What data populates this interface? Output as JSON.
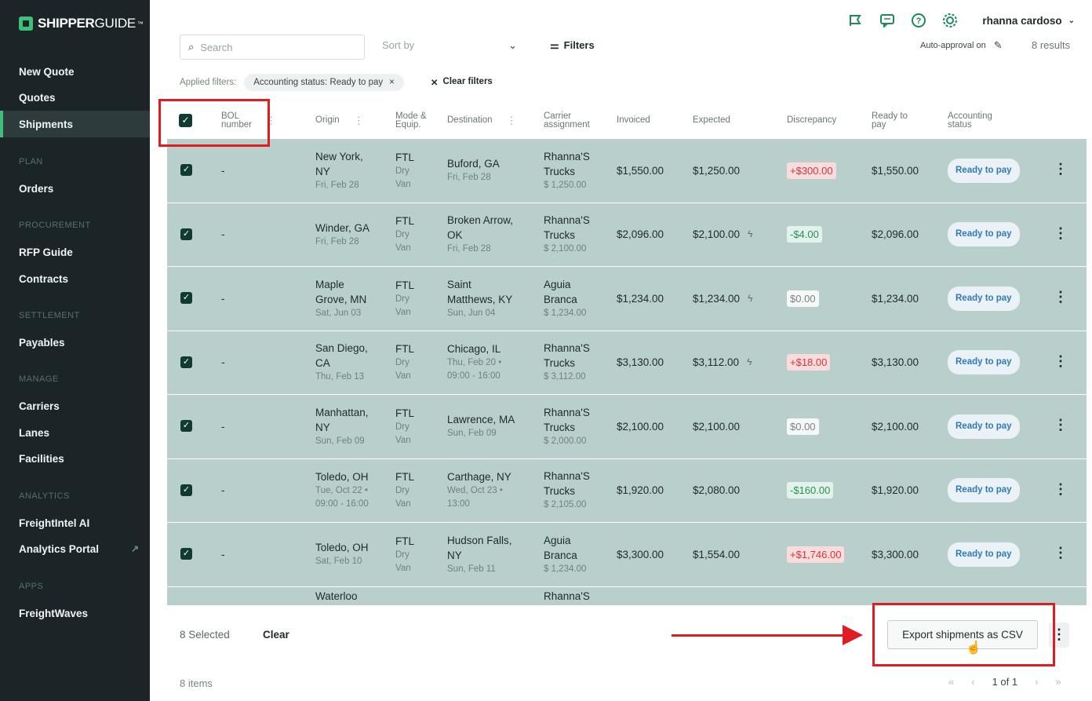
{
  "brand": {
    "name_bold": "SHIPPER",
    "name_light": "GUIDE",
    "mark": "™"
  },
  "sidebar": {
    "items": [
      {
        "label": "New Quote"
      },
      {
        "label": "Quotes"
      },
      {
        "label": "Shipments"
      },
      {
        "section": "PLAN"
      },
      {
        "label": "Orders"
      },
      {
        "section": "PROCUREMENT"
      },
      {
        "label": "RFP Guide"
      },
      {
        "label": "Contracts"
      },
      {
        "section": "SETTLEMENT"
      },
      {
        "label": "Payables"
      },
      {
        "section": "MANAGE"
      },
      {
        "label": "Carriers"
      },
      {
        "label": "Lanes"
      },
      {
        "label": "Facilities"
      },
      {
        "section": "ANALYTICS"
      },
      {
        "label": "FreightIntel AI"
      },
      {
        "label": "Analytics Portal"
      },
      {
        "section": "APPS"
      },
      {
        "label": "FreightWaves"
      }
    ],
    "active": "Shipments"
  },
  "topbar": {
    "user": "rhanna cardoso",
    "icons": [
      "flag-icon",
      "chat-icon",
      "help-icon",
      "settings-icon"
    ]
  },
  "toolbar": {
    "search_placeholder": "Search",
    "sort_placeholder": "Sort by",
    "filters_label": "Filters",
    "auto_approval": "Auto-approval on",
    "results": "8 results",
    "applied_label": "Applied filters:",
    "chip": "Accounting status: Ready to pay",
    "clear_filters": "Clear filters"
  },
  "columns": {
    "bol": "BOL number",
    "origin": "Origin",
    "mode": "Mode & Equip.",
    "destination": "Destination",
    "carrier": "Carrier assignment",
    "invoiced": "Invoiced",
    "expected": "Expected",
    "discrepancy": "Discrepancy",
    "ready": "Ready to pay",
    "status": "Accounting status"
  },
  "rows": [
    {
      "bol": "-",
      "origin": "New York, NY",
      "origin_date": "Fri, Feb 28",
      "mode": "FTL",
      "equip1": "Dry",
      "equip2": "Van",
      "dest": "Buford, GA",
      "dest_date": "Fri, Feb 28",
      "carrier": "Rhanna'S Trucks",
      "carrier_amt": "$ 1,250.00",
      "invoiced": "$1,550.00",
      "expected": "$1,250.00",
      "bolt": "",
      "disc": "+$300.00",
      "disc_type": "red",
      "ready": "$1,550.00",
      "status": "Ready to pay"
    },
    {
      "bol": "-",
      "origin": "Winder, GA",
      "origin_date": "Fri, Feb 28",
      "mode": "FTL",
      "equip1": "Dry",
      "equip2": "Van",
      "dest": "Broken Arrow, OK",
      "dest_date": "Fri, Feb 28",
      "carrier": "Rhanna'S Trucks",
      "carrier_amt": "$ 2,100.00",
      "invoiced": "$2,096.00",
      "expected": "$2,100.00",
      "bolt": "ϟ",
      "disc": "-$4.00",
      "disc_type": "green",
      "ready": "$2,096.00",
      "status": "Ready to pay"
    },
    {
      "bol": "-",
      "origin": "Maple Grove, MN",
      "origin_date": "Sat, Jun 03",
      "mode": "FTL",
      "equip1": "Dry",
      "equip2": "Van",
      "dest": "Saint Matthews, KY",
      "dest_date": "Sun, Jun 04",
      "carrier": "Aguia Branca",
      "carrier_amt": "$ 1,234.00",
      "invoiced": "$1,234.00",
      "expected": "$1,234.00",
      "bolt": "ϟ",
      "disc": "$0.00",
      "disc_type": "neutral",
      "ready": "$1,234.00",
      "status": "Ready to pay"
    },
    {
      "bol": "-",
      "origin": "San Diego, CA",
      "origin_date": "Thu, Feb 13",
      "mode": "FTL",
      "equip1": "Dry",
      "equip2": "Van",
      "dest": "Chicago, IL",
      "dest_date": "Thu, Feb 20 • 09:00 - 16:00",
      "carrier": "Rhanna'S Trucks",
      "carrier_amt": "$ 3,112.00",
      "invoiced": "$3,130.00",
      "expected": "$3,112.00",
      "bolt": "ϟ",
      "disc": "+$18.00",
      "disc_type": "red",
      "ready": "$3,130.00",
      "status": "Ready to pay"
    },
    {
      "bol": "-",
      "origin": "Manhattan, NY",
      "origin_date": "Sun, Feb 09",
      "mode": "FTL",
      "equip1": "Dry",
      "equip2": "Van",
      "dest": "Lawrence, MA",
      "dest_date": "Sun, Feb 09",
      "carrier": "Rhanna'S Trucks",
      "carrier_amt": "$ 2,000.00",
      "invoiced": "$2,100.00",
      "expected": "$2,100.00",
      "bolt": "",
      "disc": "$0.00",
      "disc_type": "neutral",
      "ready": "$2,100.00",
      "status": "Ready to pay"
    },
    {
      "bol": "-",
      "origin": "Toledo, OH",
      "origin_date": "Tue, Oct 22 • 09:00 - 16:00",
      "mode": "FTL",
      "equip1": "Dry",
      "equip2": "Van",
      "dest": "Carthage, NY",
      "dest_date": "Wed, Oct 23 • 13:00",
      "carrier": "Rhanna'S Trucks",
      "carrier_amt": "$ 2,105.00",
      "invoiced": "$1,920.00",
      "expected": "$2,080.00",
      "bolt": "",
      "disc": "-$160.00",
      "disc_type": "green",
      "ready": "$1,920.00",
      "status": "Ready to pay"
    },
    {
      "bol": "-",
      "origin": "Toledo, OH",
      "origin_date": "Sat, Feb 10",
      "mode": "FTL",
      "equip1": "Dry",
      "equip2": "Van",
      "dest": "Hudson Falls, NY",
      "dest_date": "Sun, Feb 11",
      "carrier": "Aguia Branca",
      "carrier_amt": "$ 1,234.00",
      "invoiced": "$3,300.00",
      "expected": "$1,554.00",
      "bolt": "",
      "disc": "+$1,746.00",
      "disc_type": "red",
      "ready": "$3,300.00",
      "status": "Ready to pay"
    }
  ],
  "partial_row": {
    "origin": "Waterloo",
    "carrier": "Rhanna'S"
  },
  "bottombar": {
    "selected": "8 Selected",
    "clear": "Clear",
    "export": "Export shipments as CSV"
  },
  "footer": {
    "items": "8 items",
    "page": "1 of 1"
  }
}
